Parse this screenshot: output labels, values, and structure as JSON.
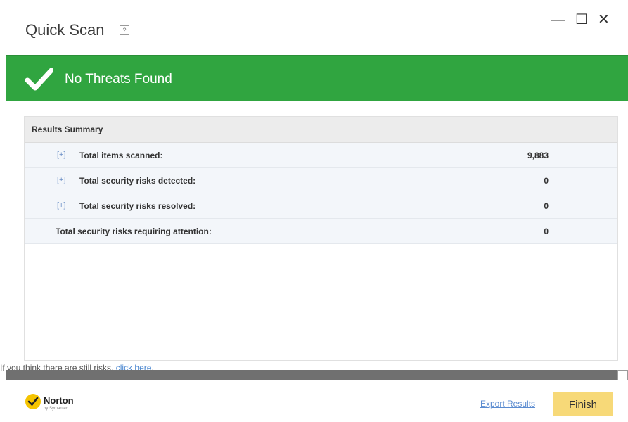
{
  "window": {
    "title": "Quick Scan",
    "help_symbol": "?",
    "controls": {
      "minimize": "—",
      "maximize": "☐",
      "close": "✕"
    }
  },
  "banner": {
    "status_text": "No Threats Found",
    "color": "#30a540",
    "icon": "checkmark-icon"
  },
  "results": {
    "header": "Results Summary",
    "rows": [
      {
        "expander": "[+]",
        "label": "Total items scanned:",
        "value": "9,883"
      },
      {
        "expander": "[+]",
        "label": "Total security risks detected:",
        "value": "0"
      },
      {
        "expander": "[+]",
        "label": "Total security risks resolved:",
        "value": "0"
      },
      {
        "label": "Total security risks requiring attention:",
        "value": "0"
      }
    ]
  },
  "hint": {
    "text": "If you think there are still risks, ",
    "link": "click here",
    "suffix": "."
  },
  "footer": {
    "brand": "Norton",
    "brand_sub": "by Symantec",
    "export_label": "Export Results",
    "finish_label": "Finish",
    "finish_color": "#f7d978"
  }
}
